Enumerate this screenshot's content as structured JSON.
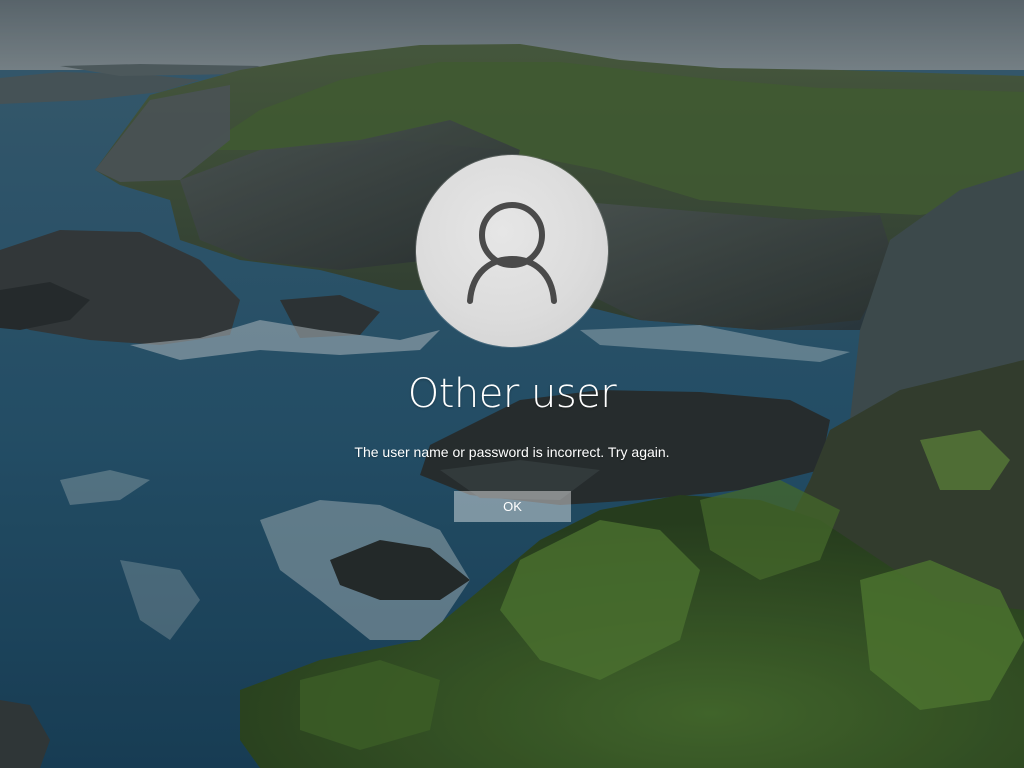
{
  "lock_screen": {
    "user_name": "Other user",
    "error_message": "The user name or password is incorrect. Try again.",
    "ok_label": "OK"
  },
  "icons": {
    "avatar": "user-silhouette-icon"
  },
  "colors": {
    "text": "#ffffff",
    "button_bg": "rgba(255,255,255,0.42)",
    "avatar_bg": "#dcdcdc",
    "avatar_glyph": "#4a4a4a"
  }
}
